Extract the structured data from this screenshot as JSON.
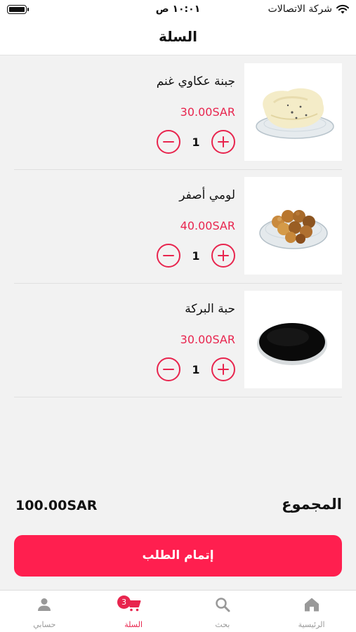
{
  "status_bar": {
    "time": "١٠:٠١ ص",
    "carrier": "شركة الاتصالات"
  },
  "header": {
    "title": "السلة"
  },
  "cart": {
    "items": [
      {
        "name": "جبنة عكاوي غنم",
        "price": "30.00SAR",
        "quantity": "1",
        "image": "akawi-cheese"
      },
      {
        "name": "لومي أصفر",
        "price": "40.00SAR",
        "quantity": "1",
        "image": "dried-lemons"
      },
      {
        "name": "حبة البركة",
        "price": "30.00SAR",
        "quantity": "1",
        "image": "black-seeds"
      }
    ]
  },
  "summary": {
    "total_label": "المجموع",
    "total_value": "100.00SAR"
  },
  "checkout": {
    "label": "إتمام الطلب"
  },
  "tabbar": {
    "items": [
      {
        "label": "الرئيسية",
        "icon": "home-icon",
        "active": false
      },
      {
        "label": "بحث",
        "icon": "search-icon",
        "active": false
      },
      {
        "label": "السلة",
        "icon": "cart-icon",
        "active": true,
        "badge": "3"
      },
      {
        "label": "حسابي",
        "icon": "user-icon",
        "active": false
      }
    ]
  },
  "colors": {
    "accent": "#e8254e",
    "button": "#ff1f4f",
    "background": "#f2f2f2",
    "inactive": "#999999"
  }
}
